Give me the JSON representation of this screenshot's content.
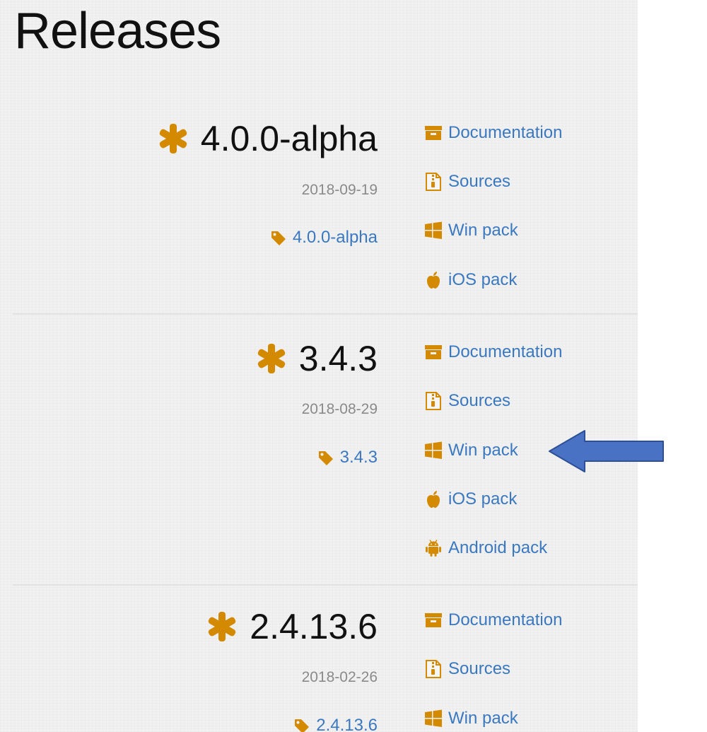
{
  "page": {
    "title": "Releases"
  },
  "colors": {
    "accent_orange": "#d48a00",
    "link_blue": "#3a78c0",
    "arrow_blue": "#4a72c4"
  },
  "releases": [
    {
      "version": "4.0.0-alpha",
      "date": "2018-09-19",
      "tag": "4.0.0-alpha",
      "links": [
        {
          "label": "Documentation",
          "icon": "archive-icon"
        },
        {
          "label": "Sources",
          "icon": "zip-file-icon"
        },
        {
          "label": "Win pack",
          "icon": "windows-icon"
        },
        {
          "label": "iOS pack",
          "icon": "apple-icon"
        }
      ]
    },
    {
      "version": "3.4.3",
      "date": "2018-08-29",
      "tag": "3.4.3",
      "links": [
        {
          "label": "Documentation",
          "icon": "archive-icon"
        },
        {
          "label": "Sources",
          "icon": "zip-file-icon"
        },
        {
          "label": "Win pack",
          "icon": "windows-icon"
        },
        {
          "label": "iOS pack",
          "icon": "apple-icon"
        },
        {
          "label": "Android pack",
          "icon": "android-icon"
        }
      ]
    },
    {
      "version": "2.4.13.6",
      "date": "2018-02-26",
      "tag": "2.4.13.6",
      "links": [
        {
          "label": "Documentation",
          "icon": "archive-icon"
        },
        {
          "label": "Sources",
          "icon": "zip-file-icon"
        },
        {
          "label": "Win pack",
          "icon": "windows-icon"
        }
      ]
    }
  ]
}
